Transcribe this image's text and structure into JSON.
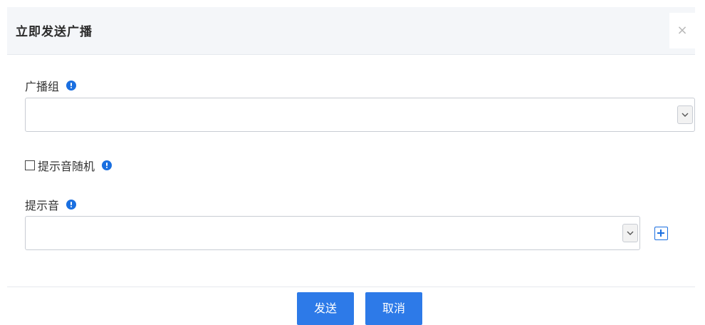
{
  "dialog": {
    "title": "立即发送广播",
    "close_label": "×"
  },
  "form": {
    "broadcast_group": {
      "label": "广播组",
      "value": ""
    },
    "random_tone": {
      "label": "提示音随机",
      "checked": false
    },
    "tone": {
      "label": "提示音",
      "value": ""
    }
  },
  "footer": {
    "send_label": "发送",
    "cancel_label": "取消"
  },
  "colors": {
    "accent": "#2d7ae8",
    "info_icon": "#1a6fe0",
    "header_bg": "#f4f6f9"
  },
  "icons": {
    "close": "close-icon",
    "info": "info-icon",
    "dropdown": "chevron-down-icon",
    "add": "plus-square-icon"
  }
}
